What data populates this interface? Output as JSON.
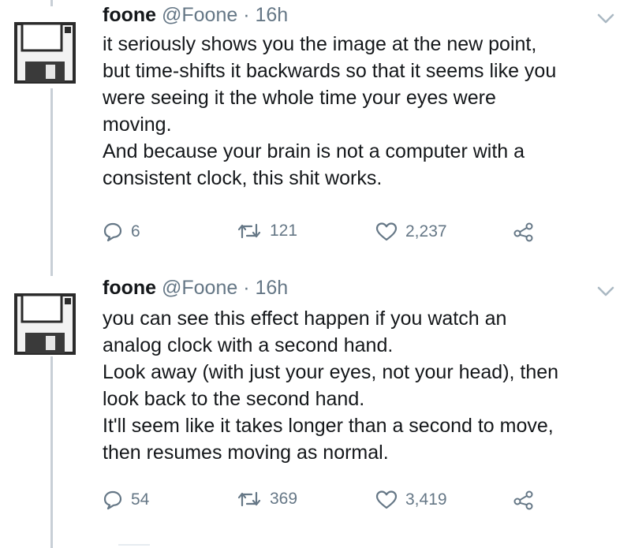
{
  "tweets": [
    {
      "name": "foone",
      "handle": "@Foone",
      "separator": "·",
      "time": "16h",
      "lines": [
        "it seriously shows you the image at the new point,",
        "but time-shifts it backwards so that it seems like you",
        "were seeing it the whole time your eyes were",
        "moving.",
        "And because your brain is not a computer with a",
        "consistent clock, this shit works."
      ],
      "replies": "6",
      "retweets": "121",
      "likes": "2,237"
    },
    {
      "name": "foone",
      "handle": "@Foone",
      "separator": "·",
      "time": "16h",
      "lines": [
        "you can see this effect happen if you watch an",
        "analog clock with a second hand.",
        "Look away (with just your eyes, not your head), then",
        "look back to the second hand.",
        "It'll seem like it takes longer than a second to move,",
        "then resumes moving as normal."
      ],
      "replies": "54",
      "retweets": "369",
      "likes": "3,419"
    }
  ],
  "icons": {
    "avatar": "floppy-disk-icon",
    "more": "chevron-down-icon",
    "reply": "reply-icon",
    "retweet": "retweet-icon",
    "like": "heart-icon",
    "share": "share-icon"
  },
  "colors": {
    "text": "#14171a",
    "muted": "#657786",
    "thread_line": "#c8cfd6"
  }
}
